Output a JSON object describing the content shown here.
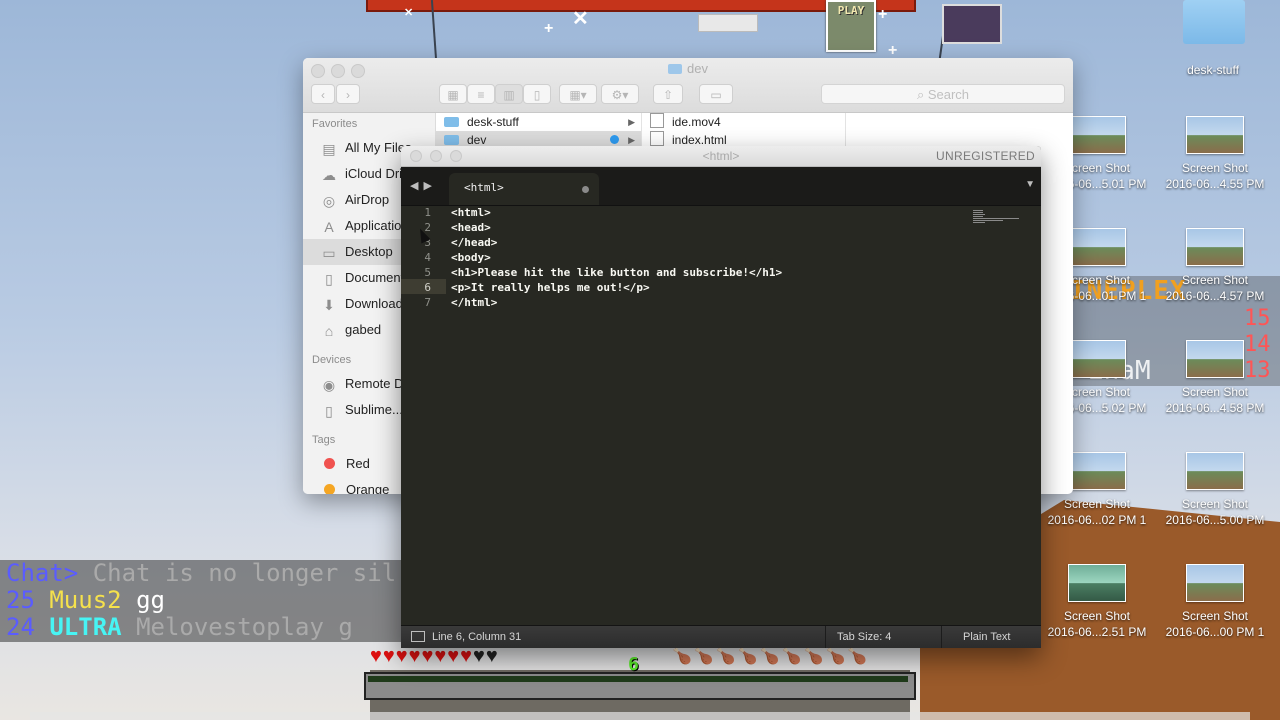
{
  "desktop": {
    "folder_label": "desk-stuff",
    "icons": [
      {
        "line1": "Screen Shot",
        "line2": "2016-06...5.01 PM"
      },
      {
        "line1": "Screen Shot",
        "line2": "2016-06...4.55 PM"
      },
      {
        "line1": "Screen Shot",
        "line2": "2016-06...01 PM 1"
      },
      {
        "line1": "Screen Shot",
        "line2": "2016-06...4.57 PM"
      },
      {
        "line1": "Screen Shot",
        "line2": "2016-06...5.02 PM"
      },
      {
        "line1": "Screen Shot",
        "line2": "2016-06...4.58 PM"
      },
      {
        "line1": "Screen Shot",
        "line2": "2016-06...02 PM 1"
      },
      {
        "line1": "Screen Shot",
        "line2": "2016-06...5.00 PM"
      },
      {
        "line1": "Screen Shot",
        "line2": "2016-06...2.51 PM"
      },
      {
        "line1": "Screen Shot",
        "line2": "2016-06...00 PM 1"
      }
    ]
  },
  "game": {
    "play_sign": "PLAY",
    "scoreboard_title": "INEPLEX",
    "scoreboard_name": "inaM",
    "scores": [
      "15",
      "14",
      "13"
    ],
    "level": "6",
    "chat": [
      {
        "prefix": "Chat>",
        "text": "Chat is no longer sil"
      },
      {
        "rank": "25",
        "name": "Muus2",
        "msg": "gg"
      },
      {
        "rank": "24",
        "tag": "ULTRA",
        "name": "Melovestoplay g"
      }
    ]
  },
  "finder": {
    "title": "dev",
    "search_placeholder": "Search",
    "sidebar": {
      "favorites_header": "Favorites",
      "favorites": [
        {
          "label": "All My Files",
          "icon": "all-files-icon"
        },
        {
          "label": "iCloud Drive",
          "icon": "cloud-icon"
        },
        {
          "label": "AirDrop",
          "icon": "airdrop-icon"
        },
        {
          "label": "Applications",
          "icon": "applications-icon"
        },
        {
          "label": "Desktop",
          "icon": "desktop-icon"
        },
        {
          "label": "Documents",
          "icon": "documents-icon"
        },
        {
          "label": "Downloads",
          "icon": "downloads-icon"
        },
        {
          "label": "gabed",
          "icon": "home-icon"
        }
      ],
      "devices_header": "Devices",
      "devices": [
        {
          "label": "Remote Disc",
          "icon": "disc-icon"
        },
        {
          "label": "Sublime...",
          "icon": "drive-icon"
        }
      ],
      "tags_header": "Tags",
      "tags": [
        {
          "label": "Red",
          "color": "#f0524f"
        },
        {
          "label": "Orange",
          "color": "#f5a623"
        }
      ]
    },
    "column1": [
      {
        "label": "desk-stuff"
      },
      {
        "label": "dev"
      }
    ],
    "column2": [
      {
        "label": "ide.mov4"
      },
      {
        "label": "index.html"
      }
    ]
  },
  "sublime": {
    "window_title": "<html>",
    "registration": "UNREGISTERED",
    "tab_label": "<html>",
    "lines": [
      {
        "num": "1",
        "text": "<html>"
      },
      {
        "num": "2",
        "text": "<head>"
      },
      {
        "num": "3",
        "text": "</head>"
      },
      {
        "num": "4",
        "text": "<body>"
      },
      {
        "num": "5",
        "text": "<h1>Please hit the like button and subscribe!</h1>"
      },
      {
        "num": "6",
        "text": "<p>It really helps me out!</p>"
      },
      {
        "num": "7",
        "text": "</html>"
      }
    ],
    "status": {
      "position": "Line 6, Column 31",
      "tab_size": "Tab Size: 4",
      "syntax": "Plain Text"
    }
  }
}
